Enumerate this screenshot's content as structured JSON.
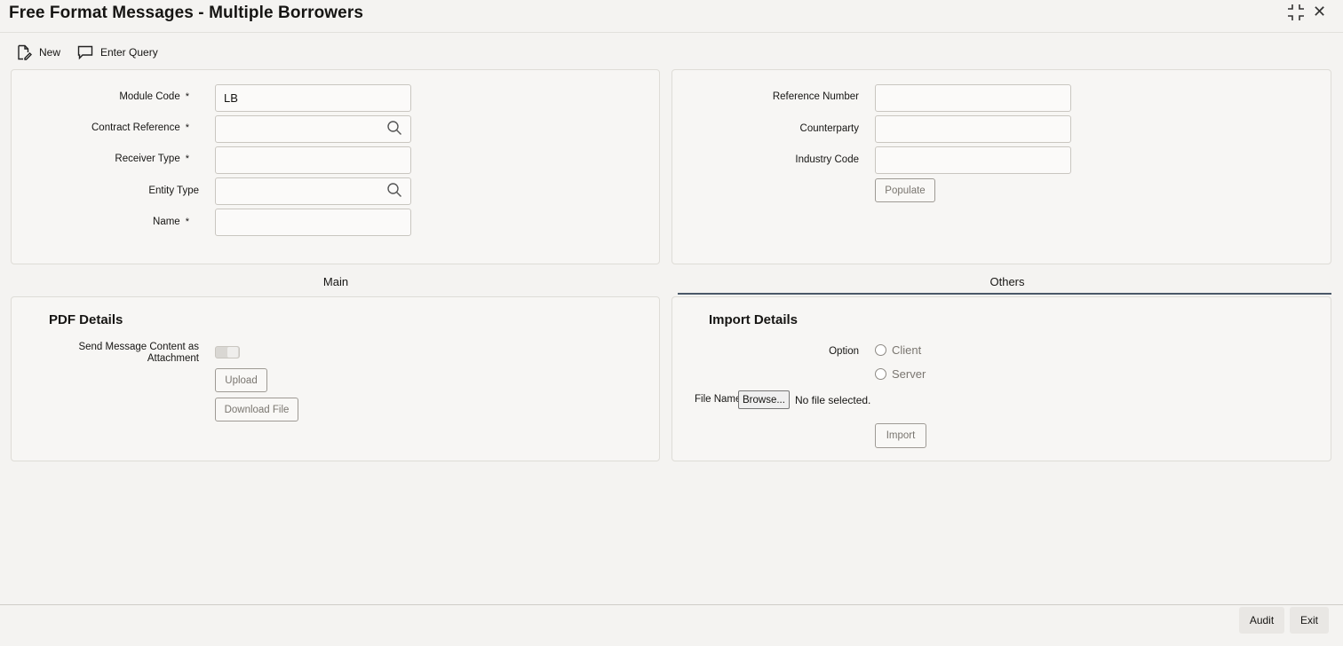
{
  "window": {
    "title": "Free Format Messages - Multiple Borrowers",
    "icons": {
      "maximize": "expand-icon",
      "close": "close-icon"
    },
    "close_glyph": "✕"
  },
  "toolbar": {
    "new_label": "New",
    "enter_query_label": "Enter Query"
  },
  "left_form": {
    "module_code": {
      "label": "Module Code",
      "value": "LB",
      "required": "*"
    },
    "contract_reference": {
      "label": "Contract Reference",
      "value": "",
      "required": "*"
    },
    "receiver_type": {
      "label": "Receiver Type",
      "value": "",
      "required": "*"
    },
    "entity_type": {
      "label": "Entity Type",
      "value": ""
    },
    "name": {
      "label": "Name",
      "value": "",
      "required": "*"
    }
  },
  "right_form": {
    "reference_number": {
      "label": "Reference Number",
      "value": ""
    },
    "counterparty": {
      "label": "Counterparty",
      "value": ""
    },
    "industry_code": {
      "label": "Industry Code",
      "value": ""
    },
    "populate_label": "Populate"
  },
  "tabs": {
    "main": "Main",
    "others": "Others",
    "active": "Others"
  },
  "pdf_details": {
    "heading": "PDF Details",
    "send_label_line1": "Send Message Content as",
    "send_label_line2": "Attachment",
    "upload_label": "Upload",
    "download_label": "Download File"
  },
  "import_details": {
    "heading": "Import Details",
    "option_label": "Option",
    "options": [
      "Client",
      "Server"
    ],
    "file_name_label": "File Name",
    "browse_label": "Browse...",
    "no_file_text": "No file selected.",
    "import_label": "Import"
  },
  "footer": {
    "audit_label": "Audit",
    "exit_label": "Exit"
  },
  "colors": {
    "tab_underline": "#4a5868",
    "background": "#f4f3f1"
  }
}
